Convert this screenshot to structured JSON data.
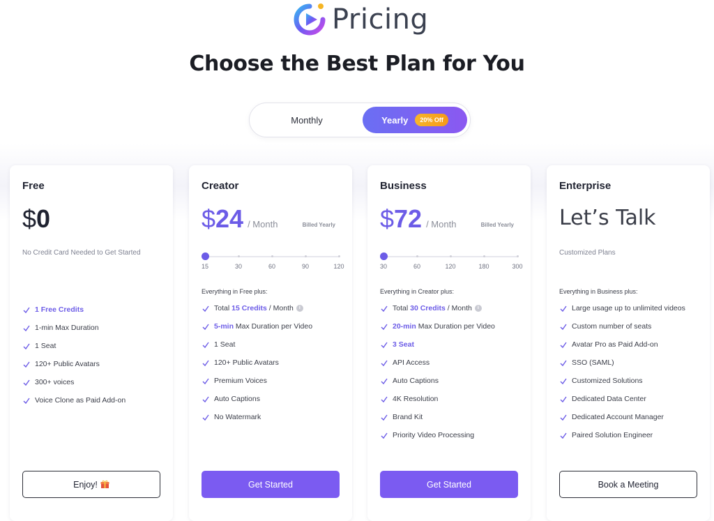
{
  "header": {
    "logo_text": "Pricing",
    "headline": "Choose the Best Plan for You"
  },
  "billing_toggle": {
    "monthly_label": "Monthly",
    "yearly_label": "Yearly",
    "yearly_badge": "20% Off",
    "selected": "Yearly"
  },
  "colors": {
    "accent": "#6c5ce7",
    "button": "#7b5bf1",
    "badge": "#f5a623"
  },
  "plans": {
    "free": {
      "name": "Free",
      "price_currency": "$",
      "price_amount": "0",
      "subline": "No Credit Card Needed to Get Started",
      "features": [
        "1 Free Credits",
        "1-min Max Duration",
        "1 Seat",
        "120+ Public Avatars",
        "300+ voices",
        "Voice Clone as Paid Add-on"
      ],
      "button_label": "Enjoy!",
      "button_icon": "gift-icon"
    },
    "creator": {
      "name": "Creator",
      "price_currency": "$",
      "price_amount": "24",
      "per": "/ Month",
      "billed": "Billed Yearly",
      "slider_ticks": [
        "15",
        "30",
        "60",
        "90",
        "120"
      ],
      "slider_selected_index": 0,
      "everything": "Everything in Free plus:",
      "f1_pre": "Total ",
      "f1_hl": "15 Credits",
      "f1_post": " / Month",
      "f2_hl": "5-min",
      "f2_post": " Max Duration per Video",
      "features_rest": [
        "1 Seat",
        "120+ Public Avatars",
        "Premium Voices",
        "Auto Captions",
        "No Watermark"
      ],
      "button_label": "Get Started"
    },
    "business": {
      "name": "Business",
      "price_currency": "$",
      "price_amount": "72",
      "per": "/ Month",
      "billed": "Billed Yearly",
      "slider_ticks": [
        "30",
        "60",
        "120",
        "180",
        "300"
      ],
      "slider_selected_index": 0,
      "everything": "Everything in Creator plus:",
      "f1_pre": "Total ",
      "f1_hl": "30 Credits",
      "f1_post": " / Month",
      "f2_hl": "20-min",
      "f2_post": " Max Duration per Video",
      "f3_hl": "3 Seat",
      "features_rest": [
        "API Access",
        "Auto Captions",
        "4K Resolution",
        "Brand Kit",
        "Priority Video Processing"
      ],
      "button_label": "Get Started"
    },
    "enterprise": {
      "name": "Enterprise",
      "price_text": "Let’s Talk",
      "subline": "Customized Plans",
      "everything": "Everything in Business plus:",
      "features": [
        "Large usage up to unlimited videos",
        "Custom number of seats",
        "Avatar Pro as Paid Add-on",
        "SSO (SAML)",
        "Customized Solutions",
        "Dedicated Data Center",
        "Dedicated Account Manager",
        "Paired Solution Engineer"
      ],
      "button_label": "Book a Meeting"
    }
  }
}
